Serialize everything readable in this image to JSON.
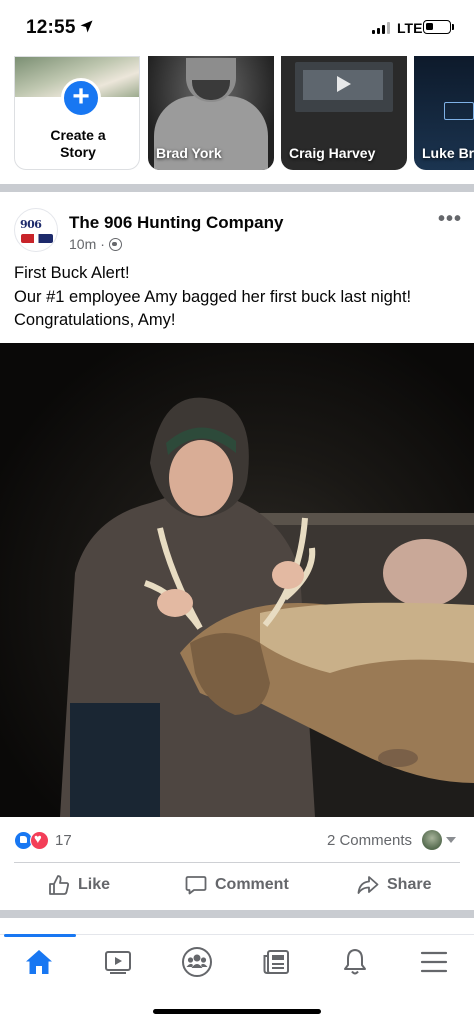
{
  "status_bar": {
    "time": "12:55",
    "network": "LTE",
    "battery_level": 0.35,
    "signal_bars": 3
  },
  "stories": {
    "create": {
      "label_line1": "Create a",
      "label_line2": "Story",
      "icon": "plus-icon"
    },
    "items": [
      {
        "name": "Brad York"
      },
      {
        "name": "Craig Harvey"
      },
      {
        "name": "Luke Br"
      }
    ]
  },
  "post": {
    "page_name": "The 906 Hunting Company",
    "avatar_text": "906",
    "time": "10m",
    "separator": "·",
    "audience_icon": "globe-icon",
    "more_icon": "more-dots-icon",
    "more_label": "•••",
    "text_lines": [
      "First Buck Alert!",
      "Our #1 employee Amy bagged her first buck last night!",
      "Congratulations, Amy!"
    ]
  },
  "engagement": {
    "reaction_count": "17",
    "reactions": [
      "like",
      "love"
    ],
    "comments": "2 Comments"
  },
  "actions": {
    "like": "Like",
    "comment": "Comment",
    "share": "Share"
  },
  "bottom_nav": {
    "active": "home",
    "items": [
      "home-icon",
      "watch-icon",
      "groups-icon",
      "news-icon",
      "notifications-icon",
      "menu-icon"
    ]
  },
  "colors": {
    "accent": "#1877f2",
    "text": "#050505",
    "secondary_text": "#65676b",
    "divider": "#c9ccd1",
    "love": "#f33e58"
  }
}
